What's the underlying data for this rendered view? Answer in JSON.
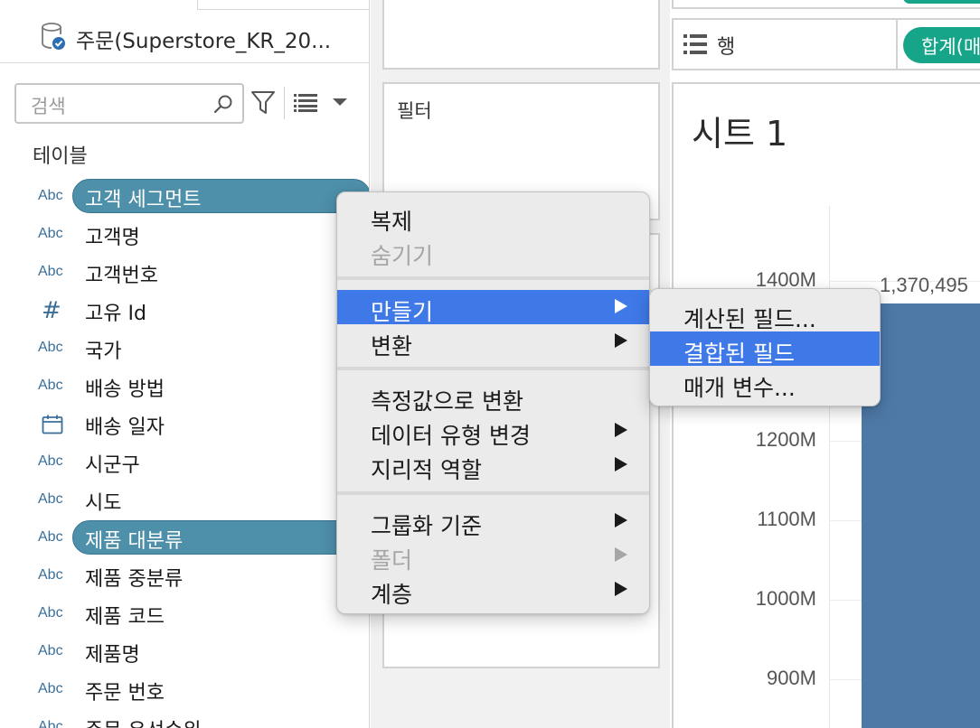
{
  "data_pane": {
    "datasource_name": "주문(Superstore_KR_20...",
    "search_placeholder": "검색",
    "tables_header": "테이블",
    "fields": [
      {
        "type": "Abc",
        "label": "고객 세그먼트",
        "selected": true
      },
      {
        "type": "Abc",
        "label": "고객명",
        "selected": false
      },
      {
        "type": "Abc",
        "label": "고객번호",
        "selected": false
      },
      {
        "type": "#",
        "label": "고유 Id",
        "selected": false
      },
      {
        "type": "Abc",
        "label": "국가",
        "selected": false
      },
      {
        "type": "Abc",
        "label": "배송 방법",
        "selected": false
      },
      {
        "type": "date",
        "label": "배송 일자",
        "selected": false
      },
      {
        "type": "Abc",
        "label": "시군구",
        "selected": false
      },
      {
        "type": "Abc",
        "label": "시도",
        "selected": false
      },
      {
        "type": "Abc",
        "label": "제품 대분류",
        "selected": true
      },
      {
        "type": "Abc",
        "label": "제품 중분류",
        "selected": false
      },
      {
        "type": "Abc",
        "label": "제품 코드",
        "selected": false
      },
      {
        "type": "Abc",
        "label": "제품명",
        "selected": false
      },
      {
        "type": "Abc",
        "label": "주문 번호",
        "selected": false
      },
      {
        "type": "Abc",
        "label": "주문 우선순위",
        "selected": false
      }
    ]
  },
  "shelves": {
    "filters_title": "필터",
    "rows_label": "행",
    "rows_pill": "합계(매"
  },
  "view": {
    "sheet_title": "시트 1",
    "ticks": [
      "1400M",
      "1200M",
      "1100M",
      "1000M",
      "900M"
    ],
    "bar_label": "1,370,495"
  },
  "context_menu": {
    "items": [
      {
        "label": "복제",
        "disabled": false,
        "submenu": false,
        "active": false
      },
      {
        "label": "숨기기",
        "disabled": true,
        "submenu": false,
        "active": false
      },
      {
        "label": "만들기",
        "disabled": false,
        "submenu": true,
        "active": true
      },
      {
        "label": "변환",
        "disabled": false,
        "submenu": true,
        "active": false
      },
      {
        "label": "측정값으로 변환",
        "disabled": false,
        "submenu": false,
        "active": false
      },
      {
        "label": "데이터 유형 변경",
        "disabled": false,
        "submenu": true,
        "active": false
      },
      {
        "label": "지리적 역할",
        "disabled": false,
        "submenu": true,
        "active": false
      },
      {
        "label": "그룹화 기준",
        "disabled": false,
        "submenu": true,
        "active": false
      },
      {
        "label": "폴더",
        "disabled": true,
        "submenu": true,
        "active": false
      },
      {
        "label": "계층",
        "disabled": false,
        "submenu": true,
        "active": false
      }
    ]
  },
  "create_submenu": {
    "items": [
      {
        "label": "계산된 필드...",
        "active": false
      },
      {
        "label": "결합된 필드",
        "active": true
      },
      {
        "label": "매개 변수...",
        "active": false
      }
    ]
  },
  "colors": {
    "selected_pill": "#4e8fa9",
    "measure_pill": "#17a58a",
    "menu_highlight": "#3f79e8",
    "bar": "#4e79a7"
  }
}
